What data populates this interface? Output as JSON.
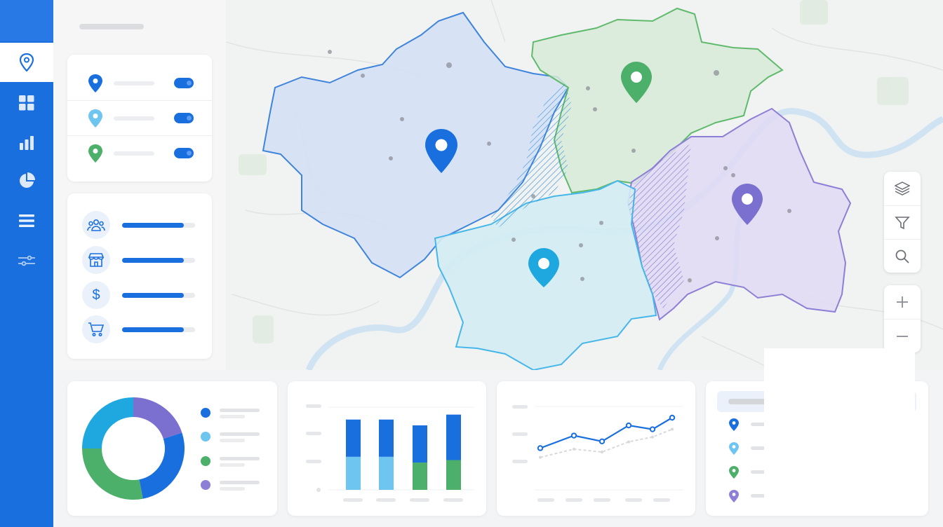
{
  "colors": {
    "sidebar": "#1a6fdf",
    "region_blue": "#1a6fdf",
    "region_cyan": "#1fa8e0",
    "region_green": "#4caf6a",
    "region_purple": "#7b6fd0",
    "light_blue": "#6ec6f0"
  },
  "sidebar": {
    "items": [
      {
        "name": "map-pin-icon",
        "active": true
      },
      {
        "name": "grid-icon"
      },
      {
        "name": "bar-chart-icon"
      },
      {
        "name": "pie-chart-icon"
      },
      {
        "name": "list-icon"
      },
      {
        "name": "sliders-icon"
      }
    ]
  },
  "layers": [
    {
      "icon": "map-pin-icon",
      "color": "#1a6fdf",
      "enabled": true
    },
    {
      "icon": "map-pin-icon",
      "color": "#6ec6f0",
      "enabled": true
    },
    {
      "icon": "map-pin-icon",
      "color": "#4caf6a",
      "enabled": true
    }
  ],
  "metrics": [
    {
      "icon": "users-icon",
      "glyph": "",
      "level": 0.84
    },
    {
      "icon": "store-icon",
      "glyph": "",
      "level": 0.84
    },
    {
      "icon": "dollar-icon",
      "glyph": "$",
      "level": 0.84
    },
    {
      "icon": "cart-icon",
      "glyph": "",
      "level": 0.84
    }
  ],
  "map_controls": [
    {
      "name": "layers-icon"
    },
    {
      "name": "filter-icon"
    },
    {
      "name": "search-icon"
    },
    {
      "name": "zoom-in-icon"
    },
    {
      "name": "zoom-out-icon"
    }
  ],
  "chart_data": [
    {
      "type": "pie",
      "donut": true,
      "values": [
        0.2,
        0.27,
        0.28,
        0.25
      ],
      "colors": [
        "#7b6fd0",
        "#1a6fdf",
        "#4caf6a",
        "#1fa8e0"
      ]
    },
    {
      "type": "bar",
      "stacked": true,
      "ylim": [
        0,
        1
      ],
      "series": [
        {
          "values": [
            0.45,
            0.45,
            0.45,
            0.55
          ],
          "colors": [
            "#1a6fdf",
            "#1a6fdf",
            "#1a6fdf",
            "#1a6fdf"
          ]
        },
        {
          "values": [
            0.4,
            0.4,
            0.33,
            0.36
          ],
          "colors": [
            "#6ec6f0",
            "#6ec6f0",
            "#4caf6a",
            "#4caf6a"
          ]
        }
      ]
    },
    {
      "type": "line",
      "ylim": [
        0,
        1
      ],
      "series": [
        {
          "values": [
            0.37,
            0.63,
            0.51,
            0.84,
            0.76,
            1.0
          ],
          "color": "#1a6fdf"
        },
        {
          "values": [
            0.18,
            0.35,
            0.29,
            0.5,
            0.6,
            0.76
          ],
          "color": "#d8d9dc",
          "dashed": true
        }
      ]
    }
  ],
  "chart_legend": [
    {
      "color": "#1a6fdf"
    },
    {
      "color": "#6ec6f0"
    },
    {
      "color": "#4caf6a"
    },
    {
      "color": "#8e7fd6"
    }
  ],
  "list": [
    {
      "icon": "map-pin-icon",
      "color": "#1a6fdf"
    },
    {
      "icon": "map-pin-icon",
      "color": "#6ec6f0"
    },
    {
      "icon": "map-pin-icon",
      "color": "#4caf6a"
    },
    {
      "icon": "map-pin-icon",
      "color": "#8e7fd6"
    }
  ]
}
